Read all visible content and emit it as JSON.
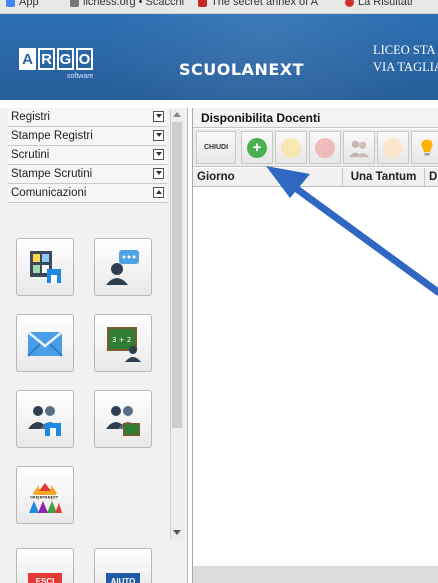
{
  "bookmarks": [
    {
      "label": "App",
      "color": "#4285f4"
    },
    {
      "label": "lichess.org • Scacchi",
      "color": "#777777"
    },
    {
      "label": "The secret annex of A",
      "color": "#c62828"
    },
    {
      "label": "La Risultati",
      "color": "#d32f2f"
    }
  ],
  "header": {
    "logo_letters": [
      "A",
      "R",
      "G",
      "O"
    ],
    "logo_subtitle": "software",
    "brand": "SCUOLANEXT",
    "school_line1": "LICEO STA",
    "school_line2": "VIA TAGLIA",
    "background": "#2a66a6"
  },
  "sidebar": {
    "items": [
      {
        "label": "Registri",
        "open": false
      },
      {
        "label": "Stampe Registri",
        "open": false
      },
      {
        "label": "Scrutini",
        "open": false
      },
      {
        "label": "Stampe Scrutini",
        "open": false
      },
      {
        "label": "Comunicazioni",
        "open": true
      }
    ],
    "icons": [
      {
        "name": "bacheca-icon"
      },
      {
        "name": "speech-person-icon"
      },
      {
        "name": "envelope-icon"
      },
      {
        "name": "blackboard-teacher-icon"
      },
      {
        "name": "group-building-icon"
      },
      {
        "name": "group-board-icon"
      },
      {
        "name": "orientanext-icon",
        "text": "ORIENTANEXT"
      }
    ],
    "bottom_buttons": [
      {
        "label": "ESCI",
        "color": "#e53935"
      },
      {
        "label": "AIUTO",
        "color": "#1e5aa8"
      }
    ]
  },
  "main": {
    "title": "Disponibilita Docenti",
    "toolbar": {
      "close_label": "CHIUDI",
      "add_color": "#4caf50",
      "edit_color": "#ffd54f",
      "delete_color": "#ef9a9a",
      "bulb_color": "#ffb300"
    },
    "columns": [
      "Giorno",
      "Una Tantum",
      "D"
    ]
  },
  "annotation": {
    "arrow_color": "#2f67c2"
  }
}
